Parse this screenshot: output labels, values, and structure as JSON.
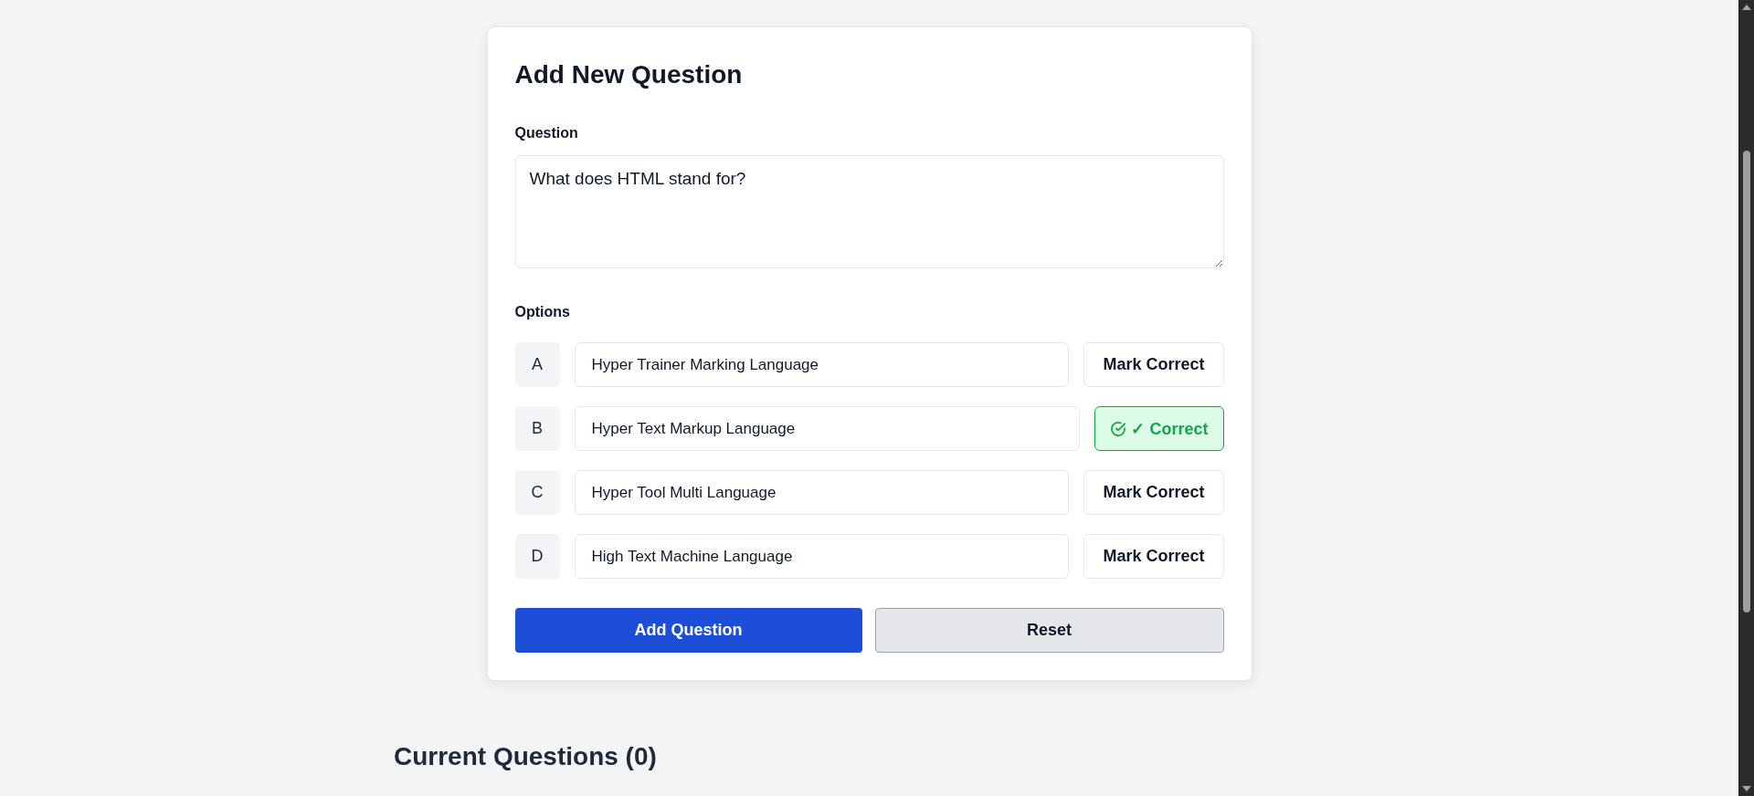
{
  "form": {
    "title": "Add New Question",
    "question_label": "Question",
    "question": {
      "value": "What does HTML stand for?"
    },
    "options_label": "Options",
    "options": [
      {
        "letter": "A",
        "value": "Hyper Trainer Marking Language",
        "selected": false,
        "button": "Mark Correct"
      },
      {
        "letter": "B",
        "value": "Hyper Text Markup Language",
        "selected": true,
        "button": "✓ Correct"
      },
      {
        "letter": "C",
        "value": "Hyper Tool Multi Language",
        "selected": false,
        "button": "Mark Correct"
      },
      {
        "letter": "D",
        "value": "High Text Machine Language",
        "selected": false,
        "button": "Mark Correct"
      }
    ],
    "buttons": [
      {
        "label": "Add Question",
        "kind": "primary"
      },
      {
        "label": "Reset",
        "kind": "secondary"
      }
    ]
  },
  "current_questions": {
    "title": "Current Questions (0)"
  }
}
